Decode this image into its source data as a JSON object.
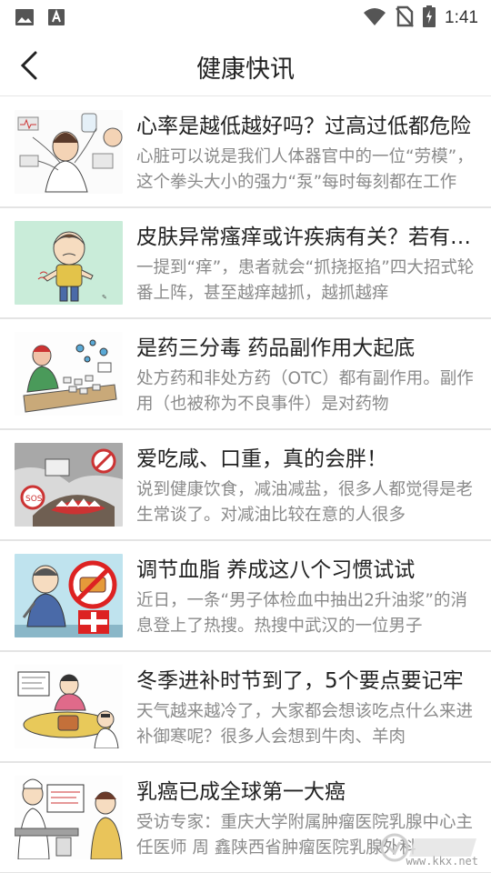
{
  "status_bar": {
    "time": "1:41",
    "icons": [
      "image-icon",
      "font-a-icon",
      "wifi-icon",
      "no-sim-icon",
      "battery-charging-icon"
    ]
  },
  "header": {
    "title": "健康快讯",
    "back_icon": "chevron-left-icon"
  },
  "news": [
    {
      "title": "心率是越低越好吗？过高过低都危险",
      "summary": "心脏可以说是我们人体器官中的一位“劳模”，这个拳头大小的强力“泵”每时每刻都在工作",
      "thumb": "heart-monitor-illustration"
    },
    {
      "title": "皮肤异常瘙痒或许疾病有关？若有这些情况",
      "summary": "一提到“痒”，患者就会“抓挠抠掐”四大招式轮番上阵，甚至越痒越抓，越抓越痒",
      "thumb": "itchy-boy-illustration"
    },
    {
      "title": "是药三分毒 药品副作用大起底",
      "summary": "处方药和非处方药（OTC）都有副作用。副作用（也被称为不良事件）是对药物",
      "thumb": "medicine-side-effect-illustration"
    },
    {
      "title": "爱吃咸、口重，真的会胖！",
      "summary": "说到健康饮食，减油减盐，很多人都觉得是老生常谈了。对减油比较在意的人很多",
      "thumb": "salty-food-illustration"
    },
    {
      "title": "调节血脂 养成这八个习惯试试",
      "summary": "近日，一条“男子体检血中抽出2升油浆”的消息登上了热搜。热搜中武汉的一位男子",
      "thumb": "blood-lipid-illustration"
    },
    {
      "title": "冬季进补时节到了，5个要点要记牢",
      "summary": "天气越来越冷了，大家都会想该吃点什么来进补御寒呢？很多人会想到牛肉、羊肉",
      "thumb": "winter-tonic-illustration"
    },
    {
      "title": "乳癌已成全球第一大癌",
      "summary": "受访专家：重庆大学附属肿瘤医院乳腺中心主任医师 周 鑫陕西省肿瘤医院乳腺外科",
      "thumb": "doctor-clinic-illustration"
    }
  ],
  "watermark": {
    "text": "www.kkx.net",
    "logo_text": "快下载"
  },
  "colors": {
    "title": "#222222",
    "summary": "#8a8a8a",
    "divider": "#e4e4e4",
    "status_icon": "#555555",
    "thumb_bg_green": "#c9ecd9"
  }
}
